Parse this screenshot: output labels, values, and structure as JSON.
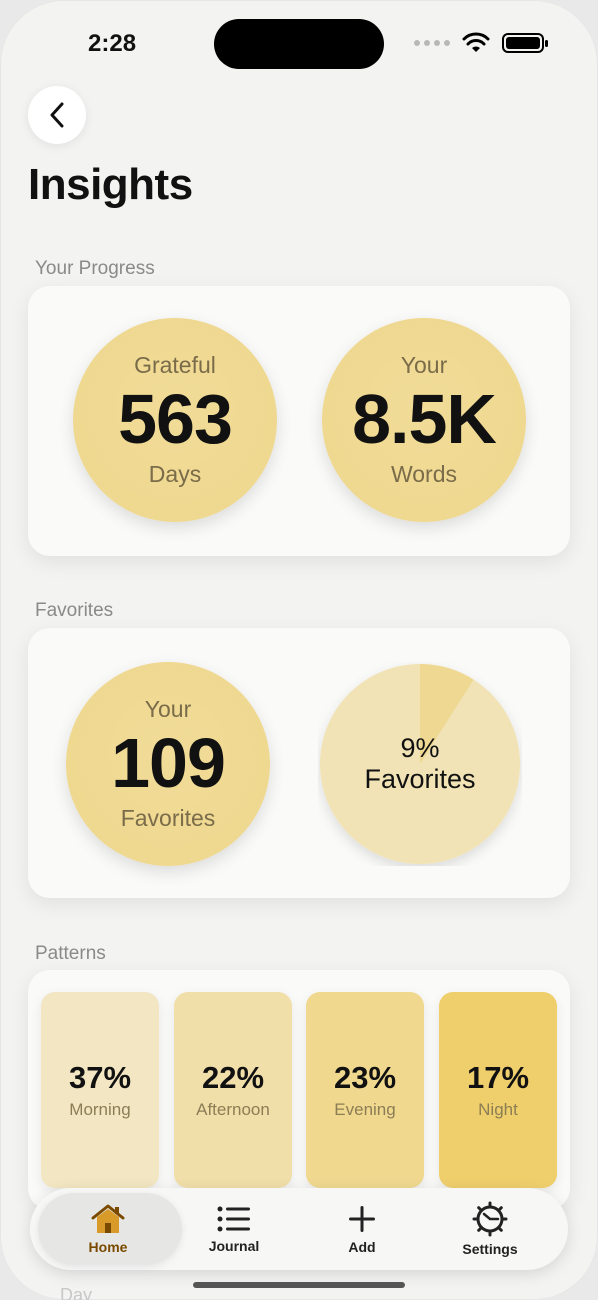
{
  "status_bar": {
    "time": "2:28"
  },
  "header": {
    "title": "Insights"
  },
  "progress": {
    "section_label": "Your Progress",
    "days": {
      "top": "Grateful",
      "value": "563",
      "bottom": "Days"
    },
    "words": {
      "top": "Your",
      "value": "8.5K",
      "bottom": "Words"
    }
  },
  "favorites": {
    "section_label": "Favorites",
    "count": {
      "top": "Your",
      "value": "109",
      "bottom": "Favorites"
    },
    "share": {
      "percent_text": "9%",
      "label": "Favorites",
      "fraction": 0.09
    }
  },
  "patterns": {
    "section_label": "Patterns",
    "tiles": [
      {
        "percent": "37%",
        "label": "Morning",
        "color": "#f3e6c2"
      },
      {
        "percent": "22%",
        "label": "Afternoon",
        "color": "#f1dfa9"
      },
      {
        "percent": "23%",
        "label": "Evening",
        "color": "#f0d98f"
      },
      {
        "percent": "17%",
        "label": "Night",
        "color": "#efcf6c"
      }
    ]
  },
  "peek_label": "Day",
  "tabbar": {
    "items": [
      {
        "label": "Home",
        "icon": "home-icon",
        "active": true
      },
      {
        "label": "Journal",
        "icon": "list-icon"
      },
      {
        "label": "Add",
        "icon": "plus-icon"
      },
      {
        "label": "Settings",
        "icon": "gear-icon"
      }
    ]
  },
  "colors": {
    "accent": "#7a4a00",
    "circle": "#efd88f"
  }
}
